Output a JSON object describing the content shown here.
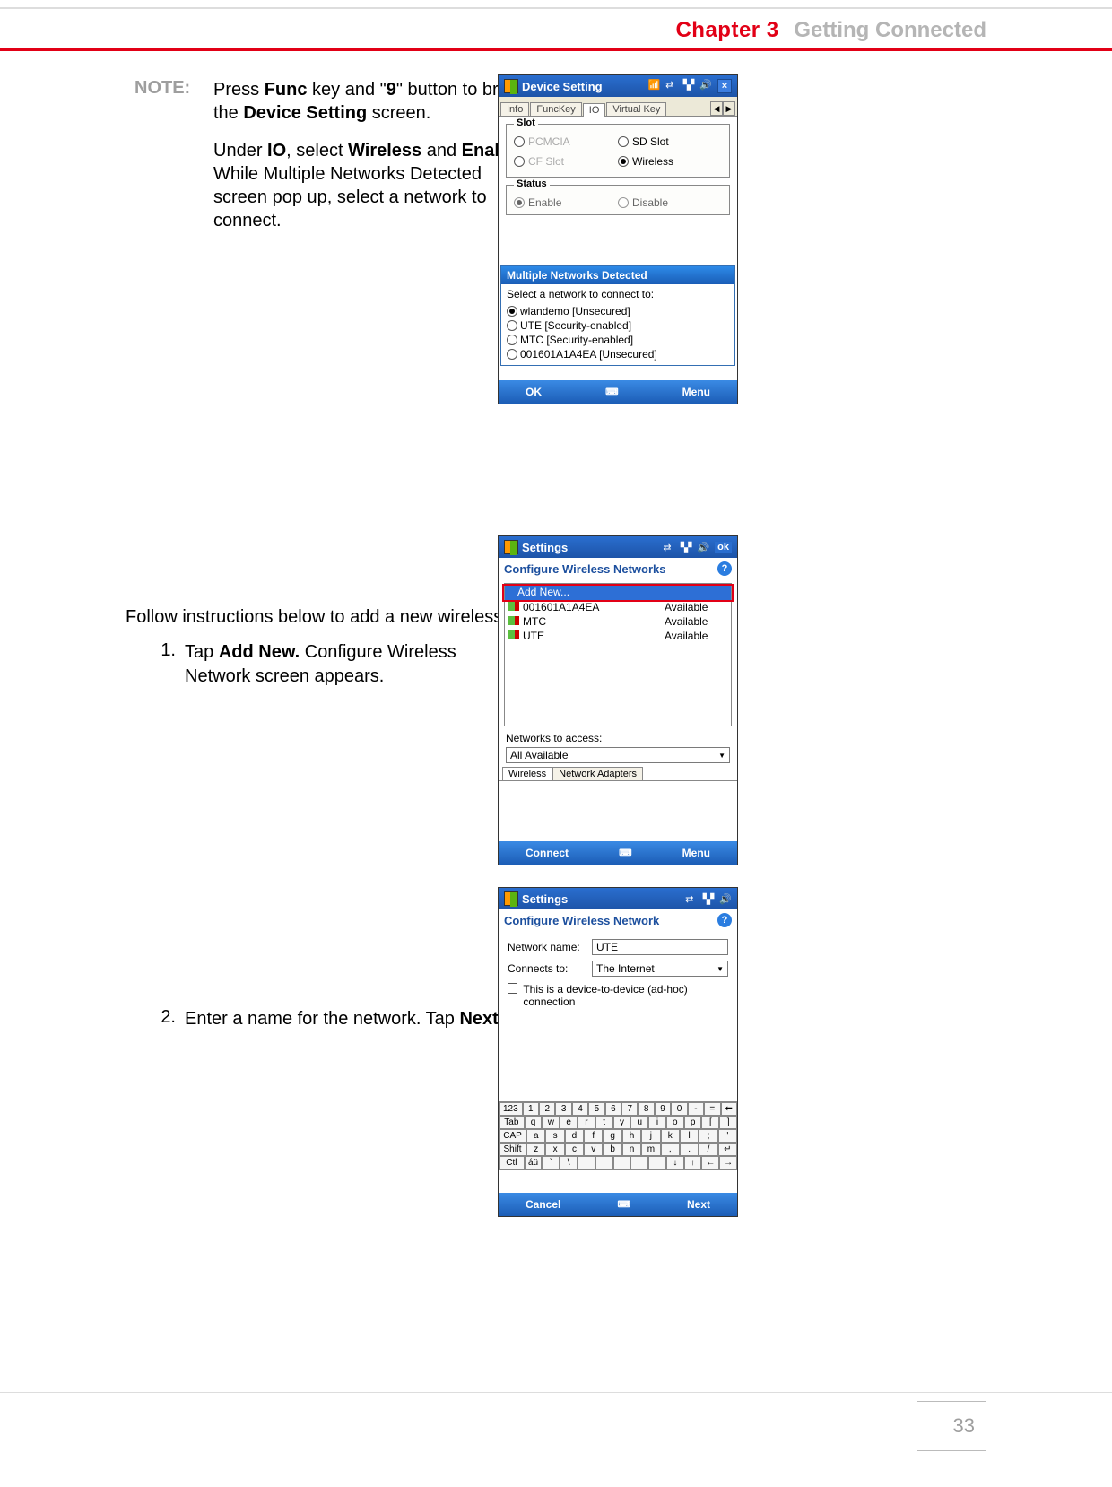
{
  "header": {
    "chapter": "Chapter 3",
    "title": "Getting Connected"
  },
  "note": {
    "label": "NOTE:",
    "p1_a": "Press ",
    "p1_b": "Func",
    "p1_c": " key and \"",
    "p1_d": "9",
    "p1_e": "\" button to bring the ",
    "p1_f": "Device Setting",
    "p1_g": " screen.",
    "p2_a": "Under ",
    "p2_b": "IO",
    "p2_c": ", select ",
    "p2_d": "Wireless",
    "p2_e": " and ",
    "p2_f": "Enable",
    "p2_g": ". While Multiple Networks Detected screen pop up, select a network to connect."
  },
  "body_intro": "Follow instructions below to add a new wireless network.",
  "steps": [
    {
      "num": "1.",
      "a": "Tap ",
      "b": "Add New.",
      "c": " Configure Wireless Network screen appears."
    },
    {
      "num": "2.",
      "a": "Enter a name for the network. Tap ",
      "b": "Next",
      "c": "."
    }
  ],
  "screen1": {
    "title": "Device Setting",
    "tabs": [
      "Info",
      "FuncKey",
      "IO",
      "Virtual Key"
    ],
    "active_tab": 2,
    "slot_title": "Slot",
    "slot_items": [
      {
        "label": "PCMCIA",
        "selected": false,
        "disabled": true
      },
      {
        "label": "SD Slot",
        "selected": false,
        "disabled": false
      },
      {
        "label": "CF Slot",
        "selected": false,
        "disabled": true
      },
      {
        "label": "Wireless",
        "selected": true,
        "disabled": false
      }
    ],
    "status_title": "Status",
    "status_items": [
      {
        "label": "Enable",
        "selected": true
      },
      {
        "label": "Disable",
        "selected": false
      }
    ],
    "popup": {
      "title": "Multiple Networks Detected",
      "prompt": "Select a network to connect to:",
      "networks": [
        {
          "name": "wlandemo [Unsecured]",
          "selected": true
        },
        {
          "name": "UTE [Security-enabled]",
          "selected": false
        },
        {
          "name": "MTC [Security-enabled]",
          "selected": false
        },
        {
          "name": "001601A1A4EA [Unsecured]",
          "selected": false
        }
      ]
    },
    "ok": "OK",
    "menu": "Menu"
  },
  "screen2": {
    "title": "Settings",
    "subtitle": "Configure Wireless Networks",
    "addnew": "Add New...",
    "networks": [
      {
        "name": "001601A1A4EA",
        "status": "Available"
      },
      {
        "name": "MTC",
        "status": "Available"
      },
      {
        "name": "UTE",
        "status": "Available"
      }
    ],
    "access_label": "Networks to access:",
    "access_value": "All Available",
    "bottom_tabs": [
      "Wireless",
      "Network Adapters"
    ],
    "connect": "Connect",
    "menu": "Menu",
    "ok": "ok"
  },
  "screen3": {
    "title": "Settings",
    "subtitle": "Configure Wireless Network",
    "name_label": "Network name:",
    "name_value": "UTE",
    "connects_label": "Connects to:",
    "connects_value": "The Internet",
    "adhoc": "This is a device-to-device (ad-hoc) connection",
    "keyboard": {
      "r1": [
        "123",
        "1",
        "2",
        "3",
        "4",
        "5",
        "6",
        "7",
        "8",
        "9",
        "0",
        "-",
        "=",
        "⬅"
      ],
      "r2": [
        "Tab",
        "q",
        "w",
        "e",
        "r",
        "t",
        "y",
        "u",
        "i",
        "o",
        "p",
        "[",
        "]"
      ],
      "r3": [
        "CAP",
        "a",
        "s",
        "d",
        "f",
        "g",
        "h",
        "j",
        "k",
        "l",
        ";",
        "'"
      ],
      "r4": [
        "Shift",
        "z",
        "x",
        "c",
        "v",
        "b",
        "n",
        "m",
        ",",
        ".",
        "/",
        "↵"
      ],
      "r5": [
        "Ctl",
        "áü",
        "`",
        "\\",
        "",
        "",
        "",
        "",
        "",
        "↓",
        "↑",
        "←",
        "→"
      ]
    },
    "cancel": "Cancel",
    "next": "Next"
  },
  "page_number": "33"
}
